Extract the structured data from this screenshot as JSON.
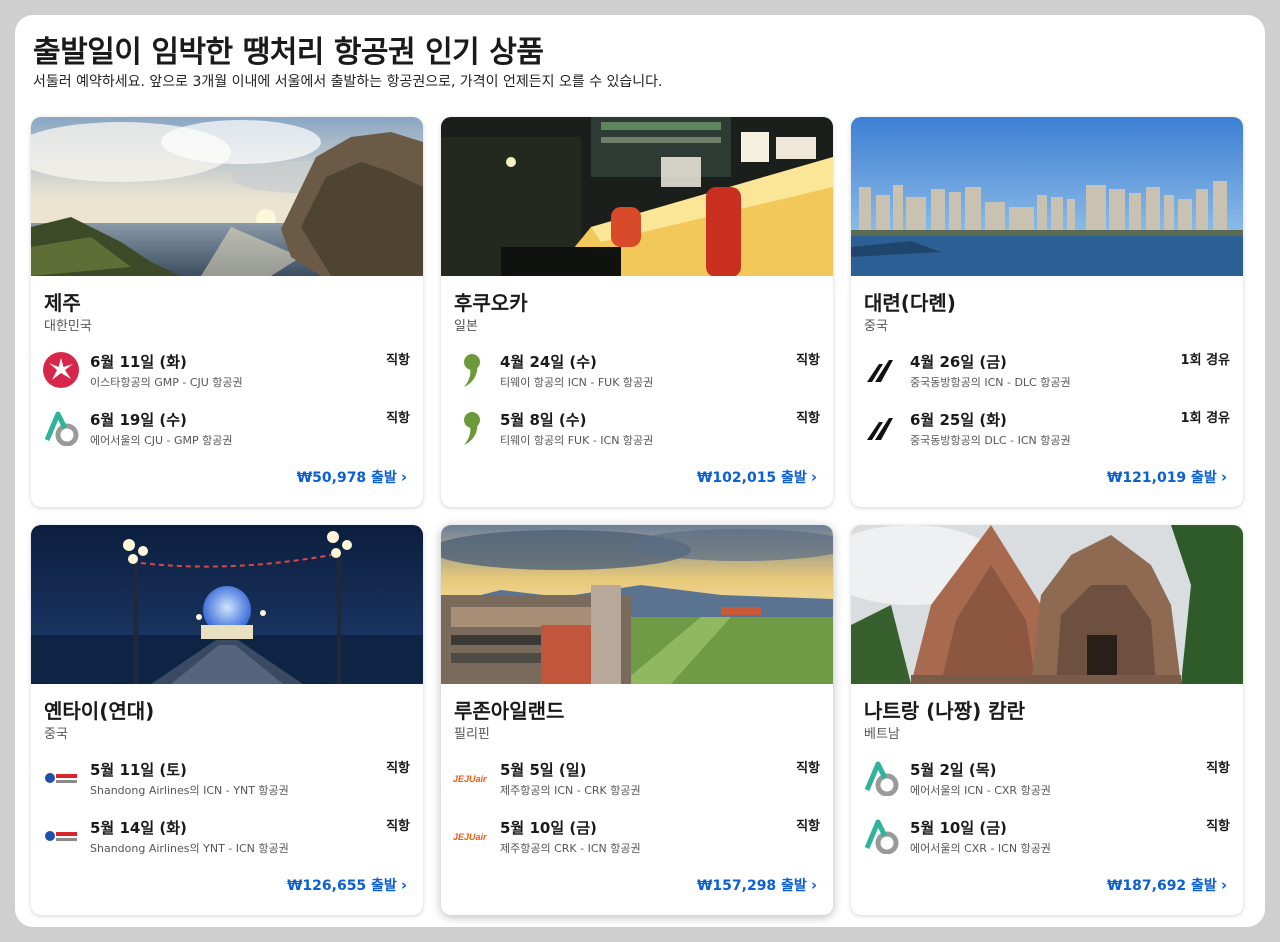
{
  "header": {
    "title": "출발일이 임박한 땡처리 항공권 인기 상품",
    "subtitle": "서둘러 예약하세요. 앞으로 3개월 이내에 서울에서 출발하는 항공권으로, 가격이 언제든지 오를 수 있습니다."
  },
  "cards": [
    {
      "city": "제주",
      "country": "대한민국",
      "price": "₩50,978 출발",
      "flights": [
        {
          "date": "6월 11일 (화)",
          "desc": "이스타항공의 GMP - CJU 항공권",
          "stops": "직항",
          "logo": "eastar-jet-logo"
        },
        {
          "date": "6월 19일 (수)",
          "desc": "에어서울의 CJU - GMP 항공권",
          "stops": "직항",
          "logo": "air-seoul-logo"
        }
      ]
    },
    {
      "city": "후쿠오카",
      "country": "일본",
      "price": "₩102,015 출발",
      "flights": [
        {
          "date": "4월 24일 (수)",
          "desc": "티웨이 항공의 ICN - FUK 항공권",
          "stops": "직항",
          "logo": "tway-logo"
        },
        {
          "date": "5월 8일 (수)",
          "desc": "티웨이 항공의 FUK - ICN 항공권",
          "stops": "직항",
          "logo": "tway-logo"
        }
      ]
    },
    {
      "city": "대련(다롄)",
      "country": "중국",
      "price": "₩121,019 출발",
      "flights": [
        {
          "date": "4월 26일 (금)",
          "desc": "중국동방항공의 ICN - DLC 항공권",
          "stops": "1회 경유",
          "logo": "china-eastern-logo"
        },
        {
          "date": "6월 25일 (화)",
          "desc": "중국동방항공의 DLC - ICN 항공권",
          "stops": "1회 경유",
          "logo": "china-eastern-logo"
        }
      ]
    },
    {
      "city": "옌타이(연대)",
      "country": "중국",
      "price": "₩126,655 출발",
      "flights": [
        {
          "date": "5월 11일 (토)",
          "desc": "Shandong Airlines의 ICN - YNT 항공권",
          "stops": "직항",
          "logo": "shandong-airlines-logo"
        },
        {
          "date": "5월 14일 (화)",
          "desc": "Shandong Airlines의 YNT - ICN 항공권",
          "stops": "직항",
          "logo": "shandong-airlines-logo"
        }
      ]
    },
    {
      "city": "루존아일랜드",
      "country": "필리핀",
      "price": "₩157,298 출발",
      "flights": [
        {
          "date": "5월 5일 (일)",
          "desc": "제주항공의 ICN - CRK 항공권",
          "stops": "직항",
          "logo": "jejuair-logo"
        },
        {
          "date": "5월 10일 (금)",
          "desc": "제주항공의 CRK - ICN 항공권",
          "stops": "직항",
          "logo": "jejuair-logo"
        }
      ]
    },
    {
      "city": "나트랑 (나짱) 캄란",
      "country": "베트남",
      "price": "₩187,692 출발",
      "flights": [
        {
          "date": "5월 2일 (목)",
          "desc": "에어서울의 ICN - CXR 항공권",
          "stops": "직항",
          "logo": "air-seoul-logo"
        },
        {
          "date": "5월 10일 (금)",
          "desc": "에어서울의 CXR - ICN 항공권",
          "stops": "직항",
          "logo": "air-seoul-logo"
        }
      ]
    }
  ],
  "logo_text": {
    "jejuair": "JEJUair"
  },
  "colors": {
    "link": "#0a5fd6",
    "eastar": "#d8264b",
    "airseoul": "#2fb39a",
    "tway": "#6a9a3a"
  }
}
